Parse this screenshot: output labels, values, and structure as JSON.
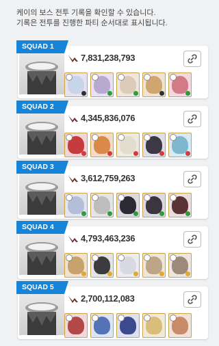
{
  "header": {
    "line1": "케이의 보스 전투 기록을 확인할 수 있습니다.",
    "line2": "기록은 전투를 진행한 파티 순서대로 표시됩니다."
  },
  "colors": {
    "squad_tag": "#1684d8",
    "gold_border": "#c9a24a"
  },
  "squads": [
    {
      "tag": "SQUAD 1",
      "damage": "7,831,238,793",
      "link_icon": "link-icon"
    },
    {
      "tag": "SQUAD 2",
      "damage": "4,345,836,076",
      "link_icon": "link-icon"
    },
    {
      "tag": "SQUAD 3",
      "damage": "3,612,759,263",
      "link_icon": "link-icon"
    },
    {
      "tag": "SQUAD 4",
      "damage": "4,793,463,236",
      "link_icon": "link-icon"
    },
    {
      "tag": "SQUAD 5",
      "damage": "2,700,112,083",
      "link_icon": "link-icon"
    }
  ]
}
